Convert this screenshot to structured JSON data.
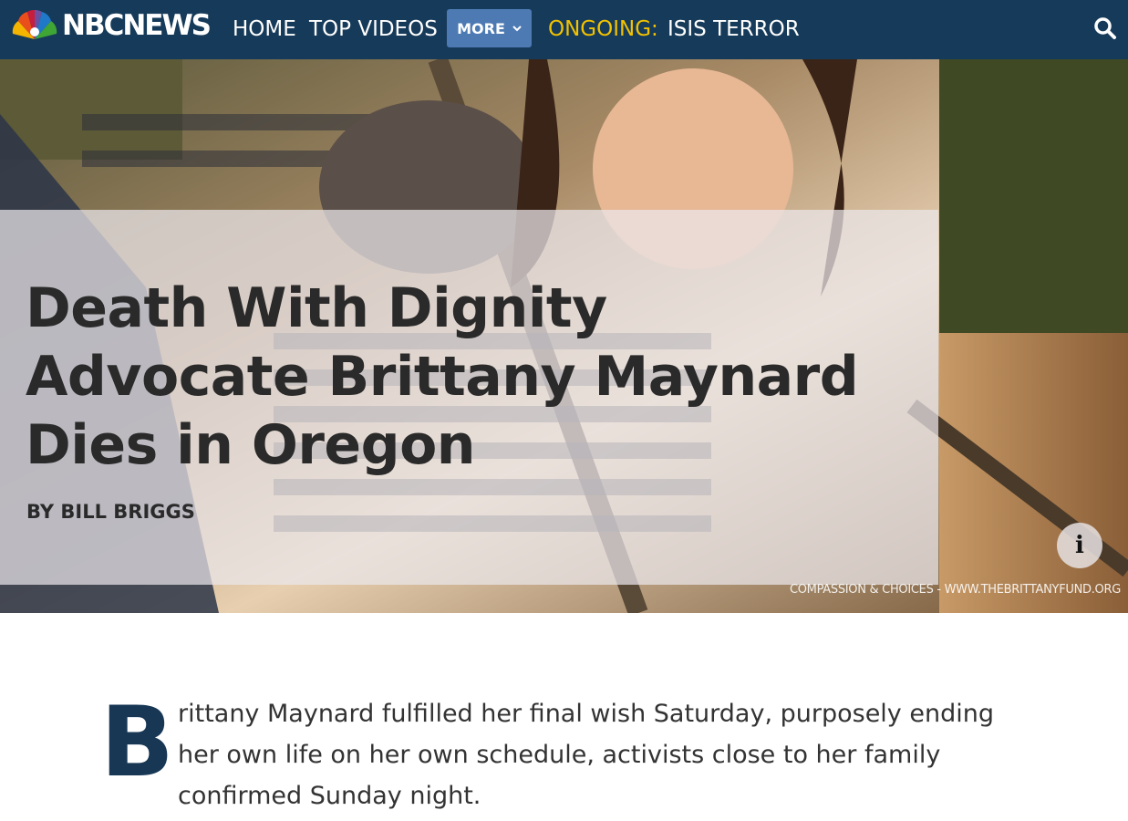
{
  "header": {
    "logo_text": "NBCNEWS",
    "nav": {
      "home": "HOME",
      "top_videos": "TOP VIDEOS",
      "more": "MORE"
    },
    "ongoing": {
      "label": "ONGOING:",
      "link": "ISIS TERROR"
    },
    "icons": {
      "logo": "nbc-peacock-icon",
      "more": "chevron-down-icon",
      "search": "search-icon"
    },
    "colors": {
      "bar": "#163a59",
      "more_button": "#4d7ab3",
      "ongoing": "#f2c200"
    }
  },
  "hero": {
    "headline": "Death With Dignity Advocate Brittany Maynard Dies in Oregon",
    "byline": "BY BILL BRIGGS",
    "info_icon": "info-icon",
    "photo_credit": "COMPASSION & CHOICES - WWW.THEBRITTANYFUND.ORG"
  },
  "article": {
    "dropcap": "B",
    "lede": "rittany Maynard fulfilled her final wish Saturday, purposely ending her own life on her own schedule, activists close to her family confirmed Sunday night.",
    "accent_color": "#173755"
  }
}
